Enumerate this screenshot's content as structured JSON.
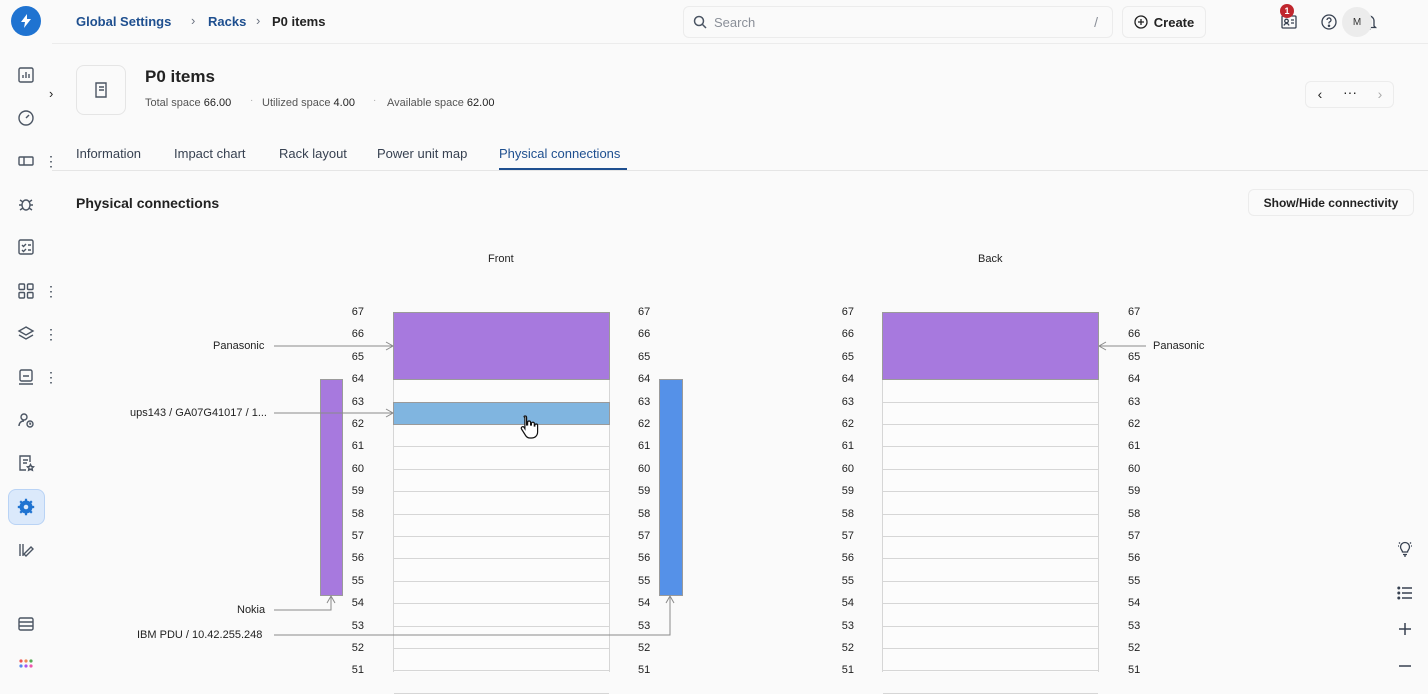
{
  "breadcrumbs": [
    {
      "label": "Global Settings"
    },
    {
      "label": "Racks"
    },
    {
      "label": "P0 items"
    }
  ],
  "search": {
    "placeholder": "Search",
    "shortcut": "/"
  },
  "header": {
    "create_label": "Create",
    "notification_count": "1",
    "avatar_initials": "M"
  },
  "page": {
    "title": "P0 items",
    "meta": [
      {
        "label": "Total space",
        "value": "66.00"
      },
      {
        "label": "Utilized space",
        "value": "4.00"
      },
      {
        "label": "Available space",
        "value": "62.00"
      }
    ]
  },
  "tabs": [
    {
      "label": "Information"
    },
    {
      "label": "Impact chart"
    },
    {
      "label": "Rack layout"
    },
    {
      "label": "Power unit map"
    },
    {
      "label": "Physical connections",
      "active": true
    }
  ],
  "section": {
    "title": "Physical connections",
    "toggle_label": "Show/Hide connectivity"
  },
  "racks": {
    "front_label": "Front",
    "back_label": "Back",
    "units": [
      "67",
      "66",
      "65",
      "64",
      "63",
      "62",
      "61",
      "60",
      "59",
      "58",
      "57",
      "56",
      "55",
      "54",
      "53",
      "52",
      "51"
    ]
  },
  "devices": {
    "front_top_color": "#a779de",
    "front_mid_color": "#80b5e0",
    "left_pdu_color": "#a779de",
    "right_pdu_color": "#5591e8"
  },
  "connections": {
    "panasonic_front": "Panasonic",
    "ups": "ups143 / GA07G41017 / 1...",
    "nokia": "Nokia",
    "ibm_pdu": "IBM PDU / 10.42.255.248",
    "panasonic_back": "Panasonic"
  },
  "icons": {
    "logo": "bolt-logo-icon",
    "nav": [
      "dashboard-icon",
      "gauge-icon",
      "ticket-icon",
      "bug-icon",
      "checklist-icon",
      "apps-icon",
      "layers-icon",
      "cmdb-icon",
      "user-clock-icon",
      "document-star-icon",
      "settings-icon",
      "tools-icon",
      "server-icon",
      "grid-dots-icon"
    ]
  }
}
